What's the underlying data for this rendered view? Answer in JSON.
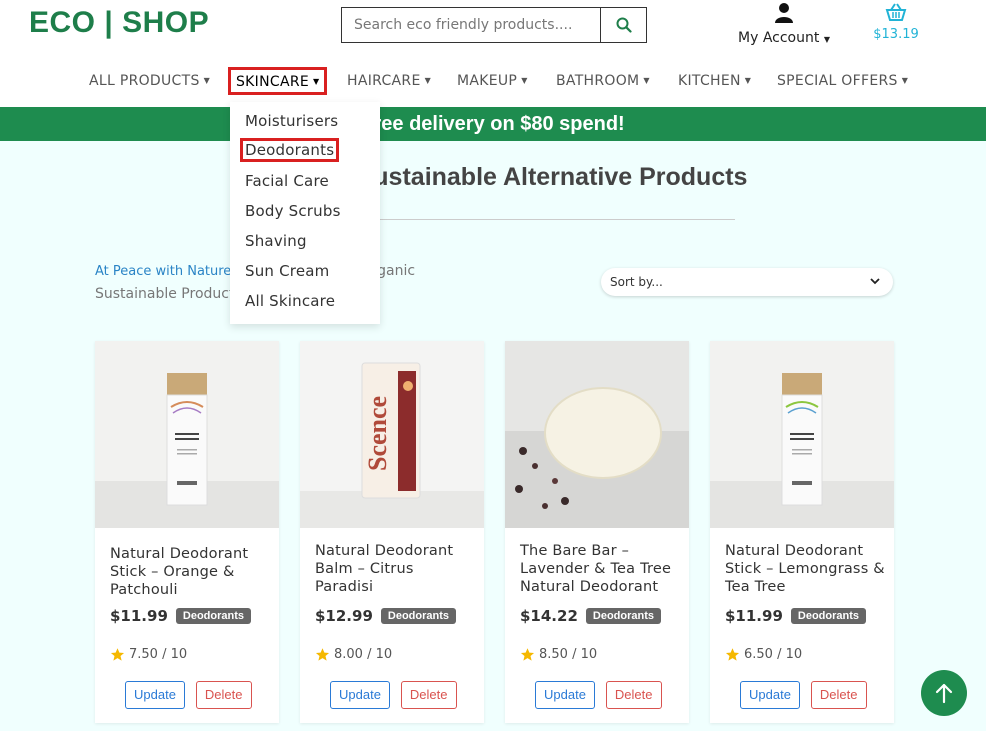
{
  "header": {
    "logo": "ECO | SHOP",
    "search_placeholder": "Search eco friendly products....",
    "account_label": "My Account",
    "cart_total": "$13.19"
  },
  "nav": {
    "items": [
      {
        "label": "ALL PRODUCTS"
      },
      {
        "label": "SKINCARE",
        "active": true
      },
      {
        "label": "HAIRCARE"
      },
      {
        "label": "MAKEUP"
      },
      {
        "label": "BATHROOM"
      },
      {
        "label": "KITCHEN"
      },
      {
        "label": "SPECIAL OFFERS"
      }
    ]
  },
  "dropdown": {
    "items": [
      {
        "label": "Moisturisers"
      },
      {
        "label": "Deodorants",
        "active": true
      },
      {
        "label": "Facial Care"
      },
      {
        "label": "Body Scrubs"
      },
      {
        "label": "Shaving"
      },
      {
        "label": "Sun Cream"
      },
      {
        "label": "All Skincare"
      }
    ]
  },
  "banner": {
    "text": "Free delivery on $80 spend!"
  },
  "page": {
    "title": "Natural & Sustainable Alternative Products",
    "intro_link": "At Peace with Nature",
    "intro_text": "provides Natural, Organic Sustainable Products",
    "sort_label": "Sort by..."
  },
  "products": [
    {
      "name": "Natural Deodorant Stick – Orange & Patchouli",
      "price": "$11.99",
      "category": "Deodorants",
      "rating": "7.50 / 10",
      "update_label": "Update",
      "delete_label": "Delete"
    },
    {
      "name": "Natural Deodorant Balm – Citrus Paradisi",
      "price": "$12.99",
      "category": "Deodorants",
      "rating": "8.00 / 10",
      "update_label": "Update",
      "delete_label": "Delete"
    },
    {
      "name": "The Bare Bar – Lavender & Tea Tree Natural Deodorant",
      "price": "$14.22",
      "category": "Deodorants",
      "rating": "8.50 / 10",
      "update_label": "Update",
      "delete_label": "Delete"
    },
    {
      "name": "Natural Deodorant Stick – Lemongrass & Tea Tree",
      "price": "$11.99",
      "category": "Deodorants",
      "rating": "6.50 / 10",
      "update_label": "Update",
      "delete_label": "Delete"
    }
  ],
  "colors": {
    "brand": "#1e7e4a",
    "banner": "#1e8c4f",
    "cart": "#21b3d6",
    "active_outline": "#d92020",
    "star": "#f5b800"
  }
}
